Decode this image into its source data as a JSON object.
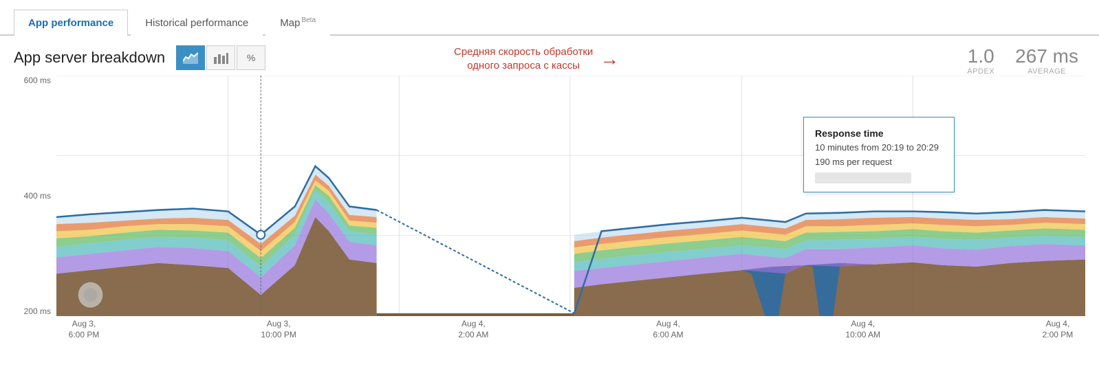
{
  "tabs": [
    {
      "id": "app-performance",
      "label": "App performance",
      "active": true
    },
    {
      "id": "historical-performance",
      "label": "Historical performance",
      "active": false
    },
    {
      "id": "map",
      "label": "Map",
      "badge": "Beta",
      "active": false
    }
  ],
  "section": {
    "title": "App server breakdown",
    "chart_type_buttons": [
      {
        "id": "area",
        "icon": "📈",
        "active": true
      },
      {
        "id": "bar",
        "icon": "📊",
        "active": false
      },
      {
        "id": "percent",
        "icon": "%",
        "active": false
      }
    ]
  },
  "annotation": {
    "text": "Средняя скорость обработки\nодного запроса с кассы",
    "arrow": "→"
  },
  "metrics": {
    "apdex": {
      "value": "1.0",
      "label": "APDEX"
    },
    "average": {
      "value": "267 ms",
      "label": "AVERAGE"
    }
  },
  "y_axis": {
    "labels": [
      "600 ms",
      "400 ms",
      "200 ms"
    ]
  },
  "x_axis": {
    "labels": [
      {
        "line1": "Aug 3,",
        "line2": "6:00 PM"
      },
      {
        "line1": "Aug 3,",
        "line2": "10:00 PM"
      },
      {
        "line1": "Aug 4,",
        "line2": "2:00 AM"
      },
      {
        "line1": "Aug 4,",
        "line2": "6:00 AM"
      },
      {
        "line1": "Aug 4,",
        "line2": "10:00 AM"
      },
      {
        "line1": "Aug 4,",
        "line2": "2:00 PM"
      }
    ]
  },
  "tooltip": {
    "title": "Response time",
    "line1": "10 minutes from 20:19 to 20:29",
    "line2": "190 ms per request"
  },
  "colors": {
    "active_tab": "#1a6eb5",
    "annotation_color": "#c0392b",
    "chart_primary": "#2e6da4",
    "tooltip_border": "#3b8fc4"
  }
}
